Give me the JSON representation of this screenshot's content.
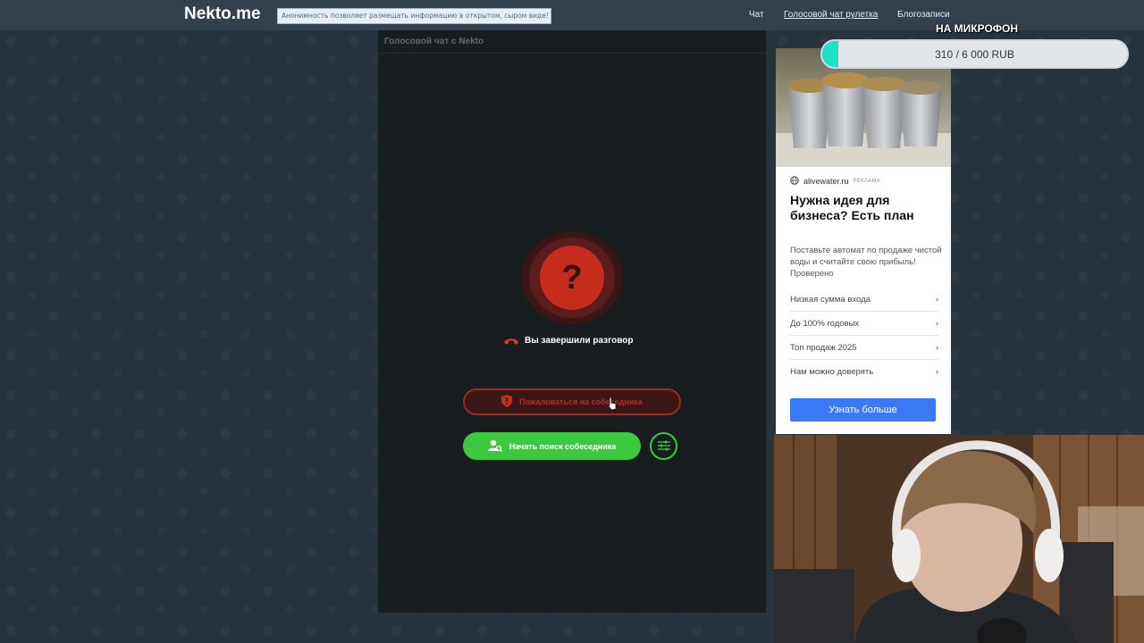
{
  "header": {
    "logo": "Nekto.me",
    "notice": "Анонимность позволяет размещать информацию в открытом, сыром виде!",
    "nav": [
      {
        "label": "Чат",
        "active": false
      },
      {
        "label": "Голосовой чат рулетка",
        "active": true
      },
      {
        "label": "Блогозаписи",
        "active": false
      }
    ]
  },
  "chat": {
    "title": "Голосовой чат с Nekto",
    "status_icon": "question-icon",
    "status_glyph": "?",
    "ended_text": "Вы завершили разговор",
    "report_label": "Пожаловаться на собеседника",
    "search_label": "Начать поиск собеседника",
    "accent_red": "#c62c1c",
    "accent_green": "#3cc83f"
  },
  "ad": {
    "source": "alivewater.ru",
    "tag": "РЕКЛАМА",
    "title": "Нужна идея для бизнеса? Есть план",
    "description": "Поставьте автомат по продаже чистой воды и считайте свою прибыль! Проверено",
    "items": [
      "Низкая сумма входа",
      "До 100% годовых",
      "Топ продаж 2025",
      "Нам можно доверять"
    ],
    "cta": "Узнать больше"
  },
  "donation": {
    "title": "НА МИКРОФОН",
    "progress_text": "310 / 6 000 RUB",
    "raised": 310,
    "goal": 6000
  }
}
